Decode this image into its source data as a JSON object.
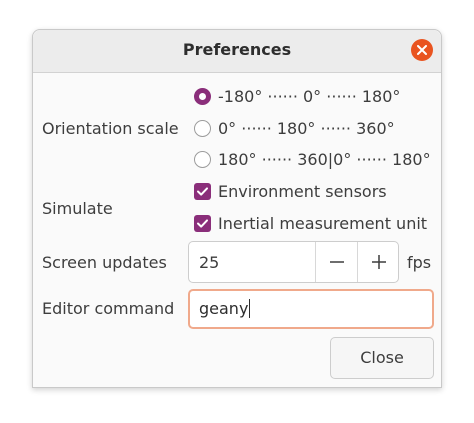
{
  "window": {
    "title": "Preferences"
  },
  "orientation": {
    "label": "Orientation scale",
    "options": [
      {
        "label": "-180° ······ 0° ······ 180°",
        "selected": true
      },
      {
        "label": "0° ······ 180° ······ 360°",
        "selected": false
      },
      {
        "label": "180° ······ 360|0° ······ 180°",
        "selected": false
      }
    ]
  },
  "simulate": {
    "label": "Simulate",
    "options": [
      {
        "label": "Environment sensors",
        "checked": true
      },
      {
        "label": "Inertial measurement unit",
        "checked": true
      }
    ]
  },
  "screen_updates": {
    "label": "Screen updates",
    "value": "25",
    "unit": "fps"
  },
  "editor": {
    "label": "Editor command",
    "value": "geany"
  },
  "footer": {
    "close_label": "Close"
  },
  "colors": {
    "accent": "#8a2e7a",
    "close_button": "#e95420",
    "focus_border": "#f0a98b"
  }
}
